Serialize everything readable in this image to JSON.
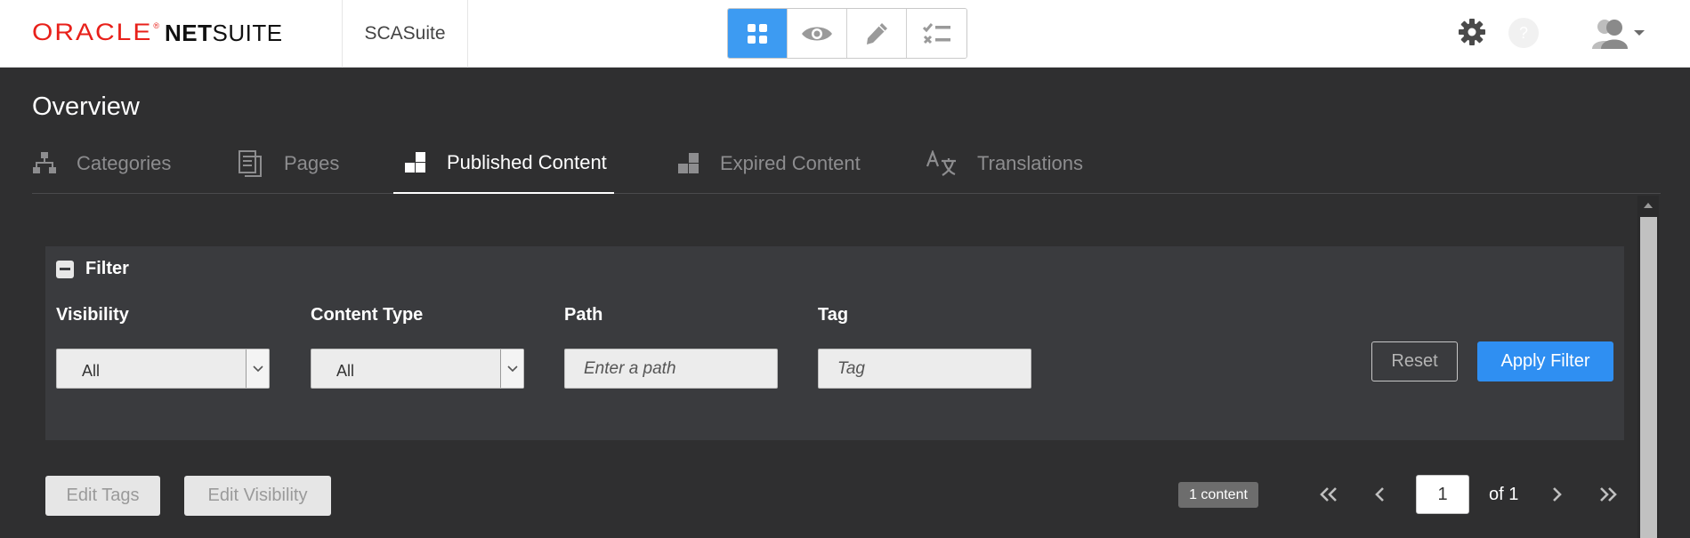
{
  "header": {
    "logo_oracle": "ORACLE",
    "logo_reg": "®",
    "logo_net": "NET",
    "logo_suite": "SUITE",
    "site_name": "SCASuite",
    "mode_buttons": [
      {
        "icon": "grid-icon",
        "active": true
      },
      {
        "icon": "eye-icon",
        "active": false
      },
      {
        "icon": "pencil-icon",
        "active": false
      },
      {
        "icon": "checklist-icon",
        "active": false
      }
    ],
    "help_glyph": "?"
  },
  "page": {
    "title": "Overview"
  },
  "tabs": [
    {
      "label": "Categories",
      "icon": "sitemap-icon",
      "active": false
    },
    {
      "label": "Pages",
      "icon": "pages-icon",
      "active": false
    },
    {
      "label": "Published Content",
      "icon": "published-blocks-icon",
      "active": true
    },
    {
      "label": "Expired Content",
      "icon": "expired-blocks-icon",
      "active": false
    },
    {
      "label": "Translations",
      "icon": "translate-icon",
      "active": false
    }
  ],
  "filter": {
    "title": "Filter",
    "visibility_label": "Visibility",
    "visibility_value": "All",
    "content_type_label": "Content Type",
    "content_type_value": "All",
    "path_label": "Path",
    "path_placeholder": "Enter a path",
    "tag_label": "Tag",
    "tag_placeholder": "Tag",
    "reset_label": "Reset",
    "apply_label": "Apply Filter"
  },
  "actions": {
    "edit_tags": "Edit Tags",
    "edit_visibility": "Edit Visibility"
  },
  "pagination": {
    "count_label": "1 content",
    "current_page": "1",
    "total_label": "of 1"
  },
  "colors": {
    "accent": "#3d9bf2",
    "apply_button": "#2f8ff2",
    "background": "#2f2f30",
    "panel": "#3a3b3e",
    "logo_red": "#e8201a"
  }
}
